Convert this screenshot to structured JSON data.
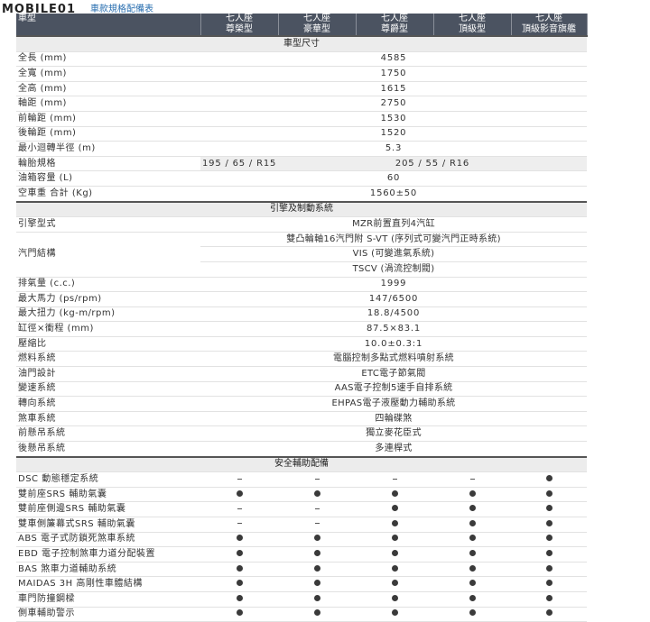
{
  "site": {
    "logo_text": "MOBILE01",
    "breadcrumb": "車款規格配備表"
  },
  "header": {
    "row_label": "車型",
    "trims": [
      {
        "line1": "七人座",
        "line2": "尊榮型"
      },
      {
        "line1": "七人座",
        "line2": "豪華型"
      },
      {
        "line1": "七人座",
        "line2": "尊爵型"
      },
      {
        "line1": "七人座",
        "line2": "頂級型"
      },
      {
        "line1": "七人座",
        "line2": "頂級影音旗艦"
      }
    ]
  },
  "sections": {
    "dimensions": "車型尺寸",
    "engine": "引擎及制動系統",
    "safety": "安全輔助配備"
  },
  "dimensions": {
    "length": {
      "label": "全長 (mm)",
      "value": "4585"
    },
    "width": {
      "label": "全寬 (mm)",
      "value": "1750"
    },
    "height": {
      "label": "全高 (mm)",
      "value": "1615"
    },
    "wheelbase": {
      "label": "軸距 (mm)",
      "value": "2750"
    },
    "front_track": {
      "label": "前輪距 (mm)",
      "value": "1530"
    },
    "rear_track": {
      "label": "後輪距 (mm)",
      "value": "1520"
    },
    "turning_radius": {
      "label": "最小迴轉半徑 (m)",
      "value": "5.3"
    },
    "tires": {
      "label": "輪胎規格",
      "value_base": "195 / 65 / R15",
      "value_others": "205 / 55 / R16"
    },
    "fuel_tank": {
      "label": "油箱容量 (L)",
      "value": "60"
    },
    "curb_weight": {
      "label": "空車重 合計 (Kg)",
      "value": "1560±50"
    }
  },
  "engine": {
    "type": {
      "label": "引擎型式",
      "value": "MZR前置直列4汽缸"
    },
    "valves": {
      "label": "汽門結構",
      "line1": "雙凸輪軸16汽門附 S-VT (序列式可變汽門正時系統)",
      "line2": "VIS (可變進氣系統)",
      "line3": "TSCV (渦流控制閥)"
    },
    "displacement": {
      "label": "排氣量 (c.c.)",
      "value": "1999"
    },
    "power": {
      "label": "最大馬力 (ps/rpm)",
      "value": "147/6500"
    },
    "torque": {
      "label": "最大扭力 (kg-m/rpm)",
      "value": "18.8/4500"
    },
    "bore_stroke": {
      "label": "缸徑×衝程 (mm)",
      "value": "87.5×83.1"
    },
    "compression": {
      "label": "壓縮比",
      "value": "10.0±0.3:1"
    },
    "fuel_system": {
      "label": "燃料系統",
      "value": "電腦控制多點式燃料噴射系統"
    },
    "throttle": {
      "label": "油門設計",
      "value": "ETC電子節氣閥"
    },
    "transmission": {
      "label": "變速系統",
      "value": "AAS電子控制5速手自排系統"
    },
    "steering": {
      "label": "轉向系統",
      "value": "EHPAS電子液壓動力輔助系統"
    },
    "brakes": {
      "label": "煞車系統",
      "value": "四輪碟煞"
    },
    "front_susp": {
      "label": "前懸吊系統",
      "value": "獨立麥花臣式"
    },
    "rear_susp": {
      "label": "後懸吊系統",
      "value": "多連桿式"
    }
  },
  "safety": {
    "rows": [
      {
        "label": "DSC 動態穩定系統",
        "marks": [
          "-",
          "-",
          "-",
          "-",
          "●"
        ]
      },
      {
        "label": "雙前座SRS 輔助氣囊",
        "marks": [
          "●",
          "●",
          "●",
          "●",
          "●"
        ]
      },
      {
        "label": "雙前座側邊SRS 輔助氣囊",
        "marks": [
          "-",
          "-",
          "●",
          "●",
          "●"
        ]
      },
      {
        "label": "雙車側簾幕式SRS 輔助氣囊",
        "marks": [
          "-",
          "-",
          "●",
          "●",
          "●"
        ]
      },
      {
        "label": "ABS 電子式防鎖死煞車系統",
        "marks": [
          "●",
          "●",
          "●",
          "●",
          "●"
        ]
      },
      {
        "label": "EBD 電子控制煞車力道分配裝置",
        "marks": [
          "●",
          "●",
          "●",
          "●",
          "●"
        ]
      },
      {
        "label": "BAS 煞車力道輔助系統",
        "marks": [
          "●",
          "●",
          "●",
          "●",
          "●"
        ]
      },
      {
        "label": "MAIDAS 3H 高剛性車體結構",
        "marks": [
          "●",
          "●",
          "●",
          "●",
          "●"
        ]
      },
      {
        "label": "車門防撞鋼樑",
        "marks": [
          "●",
          "●",
          "●",
          "●",
          "●"
        ]
      },
      {
        "label": "側車輔助警示",
        "marks": [
          "●",
          "●",
          "●",
          "●",
          "●"
        ]
      }
    ]
  }
}
